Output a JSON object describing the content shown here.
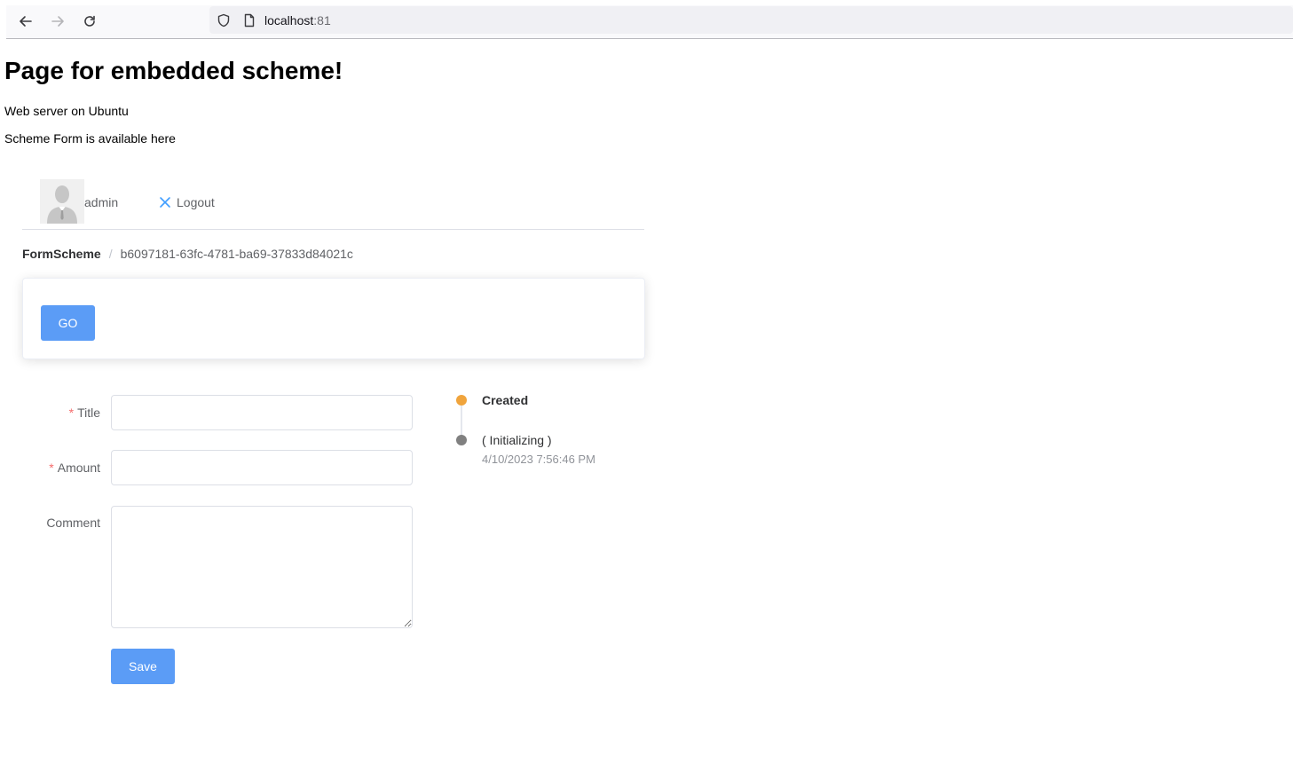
{
  "browser": {
    "url_host": "localhost",
    "url_port": ":81"
  },
  "page": {
    "title": "Page for embedded scheme!",
    "line1": "Web server on Ubuntu",
    "line2": "Scheme Form is available here"
  },
  "header": {
    "username": "admin",
    "logout_label": "Logout"
  },
  "breadcrumb": {
    "root": "FormScheme",
    "separator": "/",
    "current": "b6097181-63fc-4781-ba69-37833d84021c"
  },
  "card": {
    "go_label": "GO"
  },
  "form": {
    "required_mark": "*",
    "title_label": "Title",
    "title_value": "",
    "amount_label": "Amount",
    "amount_value": "",
    "comment_label": "Comment",
    "comment_value": "",
    "save_label": "Save"
  },
  "timeline": [
    {
      "label": "Created",
      "color": "#f0a43c"
    },
    {
      "label": "( Initializing )",
      "timestamp": "4/10/2023 7:56:46 PM",
      "color": "#808080"
    }
  ],
  "colors": {
    "primary": "#5b9cf6",
    "required": "#f56c6c"
  }
}
